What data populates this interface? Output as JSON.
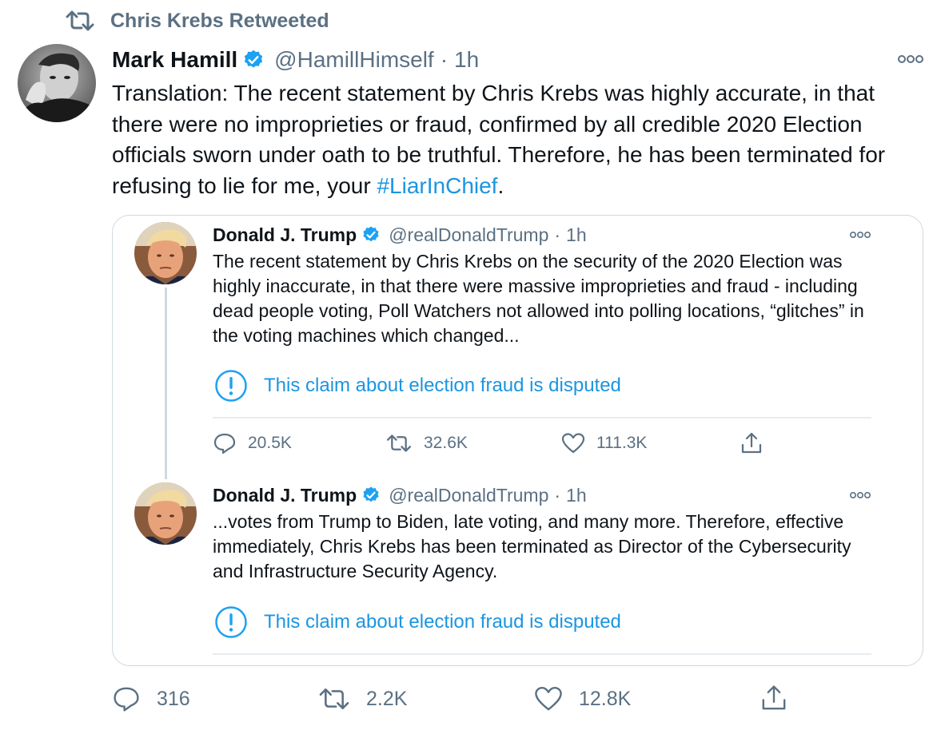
{
  "retweet_context": {
    "text": "Chris Krebs Retweeted",
    "icon": "retweet-icon"
  },
  "tweet": {
    "name": "Mark Hamill",
    "handle": "@HamillHimself",
    "separator": "·",
    "time": "1h",
    "text": "Translation: The recent statement by Chris Krebs was highly accurate, in that there were no improprieties or fraud, confirmed by all credible 2020 Election officials  sworn under oath to be truthful. Therefore, he has been terminated for refusing to lie for me, your ",
    "hashtag": "#LiarInChief",
    "text_end": ".",
    "stats": {
      "replies": "316",
      "retweets": "2.2K",
      "likes": "12.8K"
    }
  },
  "quoted": [
    {
      "name": "Donald J. Trump",
      "handle": "@realDonaldTrump",
      "separator": "·",
      "time": "1h",
      "text": "The recent statement by Chris Krebs on the security of the 2020 Election was highly inaccurate, in that there were massive improprieties and fraud - including dead people voting, Poll Watchers not allowed into polling locations, “glitches” in the voting machines which changed...",
      "notice": "This claim about election fraud is disputed",
      "stats": {
        "replies": "20.5K",
        "retweets": "32.6K",
        "likes": "111.3K"
      }
    },
    {
      "name": "Donald J. Trump",
      "handle": "@realDonaldTrump",
      "separator": "·",
      "time": "1h",
      "text": "...votes from Trump to Biden, late voting, and many more. Therefore, effective immediately, Chris Krebs has been terminated as Director of the Cybersecurity and Infrastructure Security Agency.",
      "notice": "This claim about election fraud is disputed"
    }
  ],
  "colors": {
    "text_primary": "#0f1419",
    "text_secondary": "#5b7083",
    "link": "#1b95e0",
    "verified": "#1da1f2",
    "border": "#cfd9de"
  }
}
